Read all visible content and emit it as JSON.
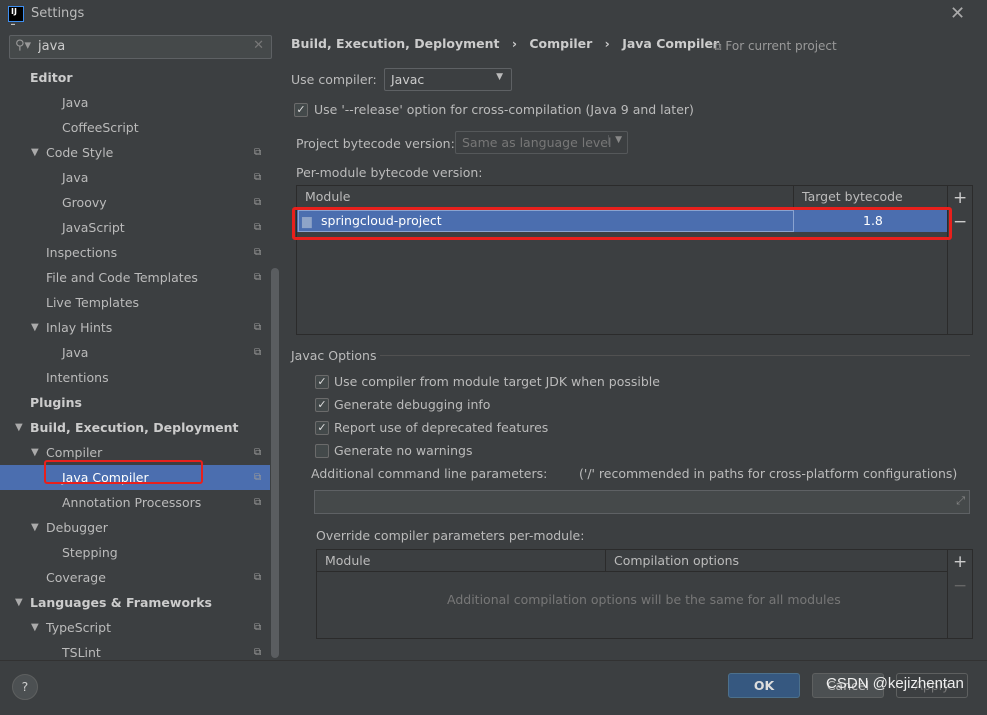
{
  "window": {
    "title": "Settings",
    "logo": "IJ",
    "close_icon": "close-icon"
  },
  "search": {
    "value": "java",
    "icon": "search-icon",
    "clear_icon": "clear-icon"
  },
  "sidebar": {
    "items": [
      {
        "label": "Editor",
        "level": 0,
        "bold": true
      },
      {
        "label": "Java",
        "level": 2
      },
      {
        "label": "CoffeeScript",
        "level": 2
      },
      {
        "label": "Code Style",
        "level": 1,
        "expanded": true,
        "copy": true
      },
      {
        "label": "Java",
        "level": 2,
        "copy": true
      },
      {
        "label": "Groovy",
        "level": 2,
        "copy": true
      },
      {
        "label": "JavaScript",
        "level": 2,
        "copy": true
      },
      {
        "label": "Inspections",
        "level": 1,
        "copy": true
      },
      {
        "label": "File and Code Templates",
        "level": 1,
        "copy": true
      },
      {
        "label": "Live Templates",
        "level": 1
      },
      {
        "label": "Inlay Hints",
        "level": 1,
        "expanded": true,
        "copy": true
      },
      {
        "label": "Java",
        "level": 2,
        "copy": true
      },
      {
        "label": "Intentions",
        "level": 1
      },
      {
        "label": "Plugins",
        "level": 0,
        "bold": true
      },
      {
        "label": "Build, Execution, Deployment",
        "level": 0,
        "bold": true,
        "expanded": true
      },
      {
        "label": "Compiler",
        "level": 1,
        "expanded": true,
        "copy": true
      },
      {
        "label": "Java Compiler",
        "level": 2,
        "selected": true,
        "copy": true
      },
      {
        "label": "Annotation Processors",
        "level": 2,
        "copy": true
      },
      {
        "label": "Debugger",
        "level": 1,
        "expanded": true
      },
      {
        "label": "Stepping",
        "level": 2
      },
      {
        "label": "Coverage",
        "level": 1,
        "copy": true
      },
      {
        "label": "Languages & Frameworks",
        "level": 0,
        "bold": true,
        "expanded": true
      },
      {
        "label": "TypeScript",
        "level": 1,
        "expanded": true,
        "copy": true
      },
      {
        "label": "TSLint",
        "level": 2,
        "copy": true
      }
    ]
  },
  "breadcrumb": {
    "items": [
      "Build, Execution, Deployment",
      "Java Compiler",
      "Compiler"
    ],
    "sep": "›",
    "scope": "For current project"
  },
  "compiler": {
    "label": "Use compiler:",
    "value": "Javac",
    "release_option": "Use '--release' option for cross-compilation (Java 9 and later)",
    "release_checked": true,
    "bytecode_label": "Project bytecode version:",
    "bytecode_value": "Same as language level",
    "per_module_label": "Per-module bytecode version:",
    "table": {
      "headers": [
        "Module",
        "Target bytecode version"
      ],
      "rows": [
        {
          "module": "springcloud-project",
          "version": "1.8"
        }
      ]
    }
  },
  "javac": {
    "section": "Javac Options",
    "options": [
      {
        "label": "Use compiler from module target JDK when possible",
        "checked": true
      },
      {
        "label": "Generate debugging info",
        "checked": true
      },
      {
        "label": "Report use of deprecated features",
        "checked": true
      },
      {
        "label": "Generate no warnings",
        "checked": false
      }
    ],
    "additional_label": "Additional command line parameters:",
    "additional_hint": "('/' recommended in paths for cross-platform configurations)",
    "additional_value": "",
    "override_label": "Override compiler parameters per-module:",
    "override_headers": [
      "Module",
      "Compilation options"
    ],
    "override_empty": "Additional compilation options will be the same for all modules"
  },
  "footer": {
    "help": "?",
    "ok": "OK",
    "cancel": "Cancel",
    "apply": "Apply",
    "watermark": "CSDN @kejizhentan"
  },
  "colors": {
    "accent": "#4b6eaf",
    "highlight_box": "#e8201c",
    "ok_button": "#365880"
  }
}
